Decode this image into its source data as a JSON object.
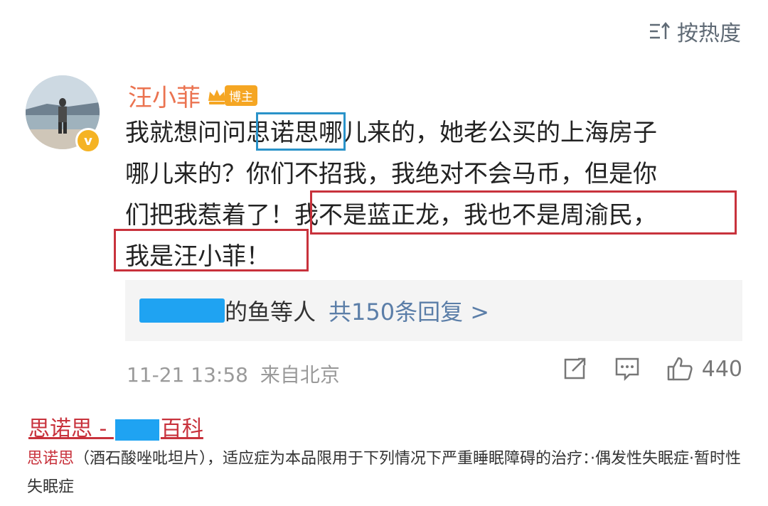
{
  "sort": {
    "label": "按热度",
    "icon": "sort-icon"
  },
  "comment": {
    "author": "汪小菲",
    "badge": "博主",
    "line1_pre": "我就想问问",
    "line1_hl": "思诺思",
    "line1_post": "哪儿来的，她老公买的上海房子",
    "line2": "哪儿来的？你们不招我，我绝对不会马币，但是你",
    "line3_pre": "们把我惹着了！",
    "line3_hl": "我不是蓝正龙，我也不是周渝民，",
    "line4_hl": "我是汪小菲！",
    "replies_people": "的鱼等人",
    "replies_count": "共150条回复 >",
    "timestamp": "11-21 13:58",
    "location": "来自北京",
    "likes": "440"
  },
  "baike": {
    "title_pre": "思诺思 - ",
    "title_post": "百科",
    "desc_term": "思诺思",
    "desc_body": "（酒石酸唑吡坦片），适应症为本品限用于下列情况下严重睡眠障碍的治疗：·偶发性失眠症·暂时性失眠症"
  },
  "colors": {
    "accent_name": "#eb7350",
    "link_blue": "#5b7ea8",
    "highlight_red": "#c8323c",
    "highlight_blue": "#2a93c9"
  }
}
